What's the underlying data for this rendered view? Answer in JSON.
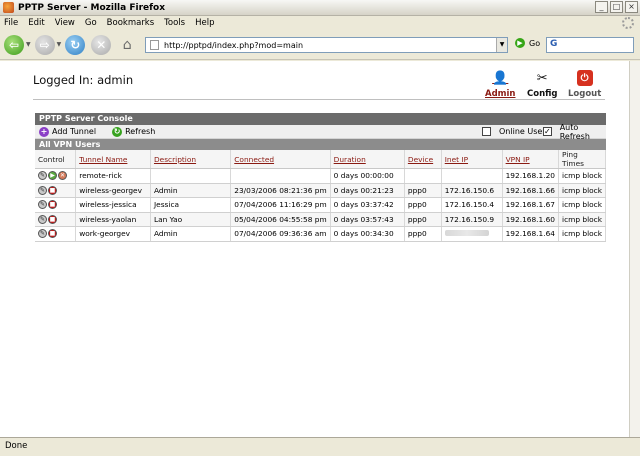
{
  "window": {
    "title": "PPTP Server - Mozilla Firefox"
  },
  "menu": [
    "File",
    "Edit",
    "View",
    "Go",
    "Bookmarks",
    "Tools",
    "Help"
  ],
  "nav": {
    "url": "http://pptpd/index.php?mod=main",
    "go_label": "Go"
  },
  "page": {
    "logged_in": "Logged In: admin",
    "links": {
      "admin": "Admin",
      "config": "Config",
      "logout": "Logout"
    },
    "console_title": "PPTP Server Console",
    "actions": {
      "add": "Add Tunnel",
      "refresh": "Refresh"
    },
    "checkboxes": {
      "online": {
        "label": "Online Users",
        "checked": false
      },
      "auto": {
        "label": "Auto Refresh",
        "checked": true
      }
    },
    "section_title": "All VPN Users"
  },
  "table": {
    "headers": [
      "Control",
      "Tunnel Name",
      "Description",
      "Connected",
      "Duration",
      "Device",
      "Inet IP",
      "VPN IP",
      "Ping Times"
    ],
    "rows": [
      {
        "name": "remote-rick",
        "desc": "",
        "connected": "",
        "duration": "0 days 00:00:00",
        "device": "",
        "inet": "",
        "vpn": "192.168.1.20",
        "ping": "icmp block",
        "state": "idle"
      },
      {
        "name": "wireless-georgev",
        "desc": "Admin",
        "connected": "23/03/2006 08:21:36 pm",
        "duration": "0 days 00:21:23",
        "device": "ppp0",
        "inet": "172.16.150.6",
        "vpn": "192.168.1.66",
        "ping": "icmp block",
        "state": "active"
      },
      {
        "name": "wireless-jessica",
        "desc": "Jessica",
        "connected": "07/04/2006 11:16:29 pm",
        "duration": "0 days 03:37:42",
        "device": "ppp0",
        "inet": "172.16.150.4",
        "vpn": "192.168.1.67",
        "ping": "icmp block",
        "state": "active"
      },
      {
        "name": "wireless-yaolan",
        "desc": "Lan Yao",
        "connected": "05/04/2006 04:55:58 pm",
        "duration": "0 days 03:57:43",
        "device": "ppp0",
        "inet": "172.16.150.9",
        "vpn": "192.168.1.60",
        "ping": "icmp block",
        "state": "active"
      },
      {
        "name": "work-georgev",
        "desc": "Admin",
        "connected": "07/04/2006 09:36:36 am",
        "duration": "0 days 00:34:30",
        "device": "ppp0",
        "inet": "",
        "vpn": "192.168.1.64",
        "ping": "icmp block",
        "state": "active",
        "inet_blurred": true
      }
    ]
  },
  "status": {
    "text": "Done"
  },
  "colors": {
    "accent_link": "#8a1a12",
    "console_head": "#6b6b6b"
  }
}
